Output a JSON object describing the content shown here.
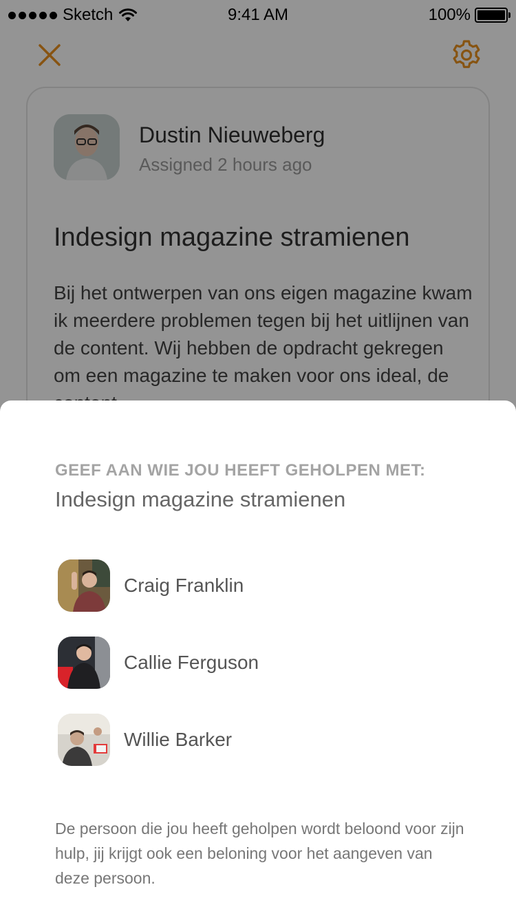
{
  "status_bar": {
    "carrier": "Sketch",
    "time": "9:41 AM",
    "battery": "100%"
  },
  "toolbar": {
    "close_icon": "close-icon",
    "settings_icon": "gear-icon",
    "accent_color": "#E89220"
  },
  "task_card": {
    "assignee_name": "Dustin Nieuweberg",
    "assigned_meta": "Assigned 2 hours ago",
    "title": "Indesign magazine stramienen",
    "description": "Bij het ontwerpen van ons eigen magazine kwam ik meerdere problemen tegen bij het uitlijnen van de content. Wij hebben de opdracht gekregen om een magazine te maken voor ons ideal, de content"
  },
  "sheet": {
    "heading": "GEEF AAN WIE JOU HEEFT GEHOLPEN MET:",
    "subtitle": "Indesign magazine stramienen",
    "people": [
      {
        "name": "Craig Franklin"
      },
      {
        "name": "Callie Ferguson"
      },
      {
        "name": "Willie Barker"
      }
    ],
    "footer_note": "De persoon die jou heeft geholpen wordt beloond voor zijn hulp, jij krijgt ook een beloning voor het aangeven van deze persoon."
  }
}
